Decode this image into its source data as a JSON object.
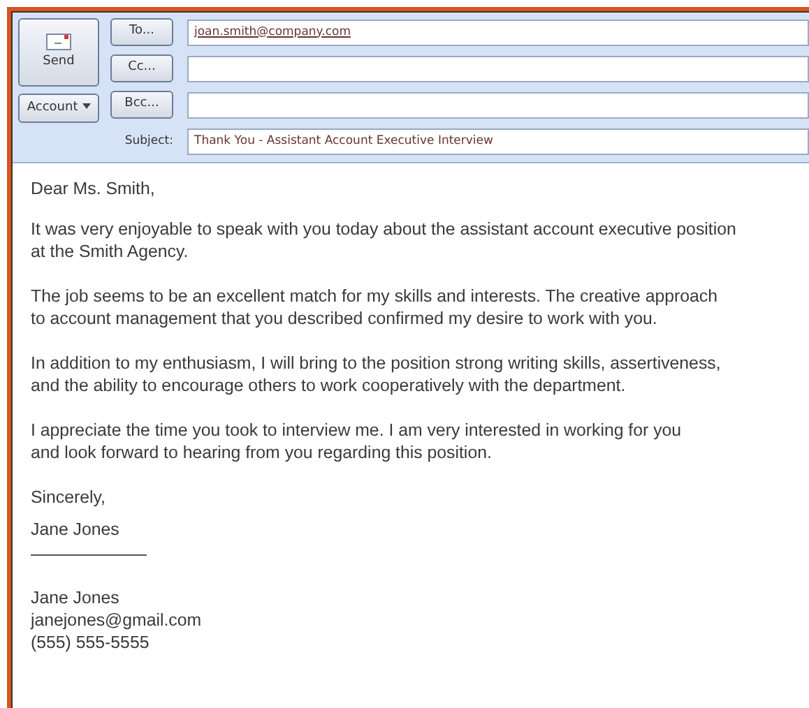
{
  "send_button": "Send",
  "account_button": "Account",
  "address_fields": [
    {
      "button": "To...",
      "value": "joan.smith@company.com"
    },
    {
      "button": "Cc..."
    },
    {
      "button": "Bcc..."
    }
  ],
  "subject": {
    "label": "Subject:",
    "value": "Thank You - Assistant Account Executive Interview"
  },
  "body": {
    "greeting": "Dear Ms. Smith,",
    "paragraphs": [
      [
        "It was very enjoyable to speak with you today about the assistant account executive position",
        "at the Smith Agency."
      ],
      [
        "The job seems to be an excellent match for my skills and interests. The creative approach",
        "to account management that you described confirmed my desire to work with you."
      ],
      [
        "In addition to my enthusiasm, I will bring to the position strong writing skills, assertiveness,",
        "and the ability to encourage others to work cooperatively with the department."
      ],
      [
        "I appreciate the time you took to interview me. I am very interested in working for you",
        "and look forward to hearing from you regarding this position."
      ]
    ],
    "closing": "Sincerely,",
    "signature_name": "Jane Jones",
    "contact": [
      "Jane Jones",
      "janejones@gmail.com",
      "(555) 555-5555"
    ]
  }
}
